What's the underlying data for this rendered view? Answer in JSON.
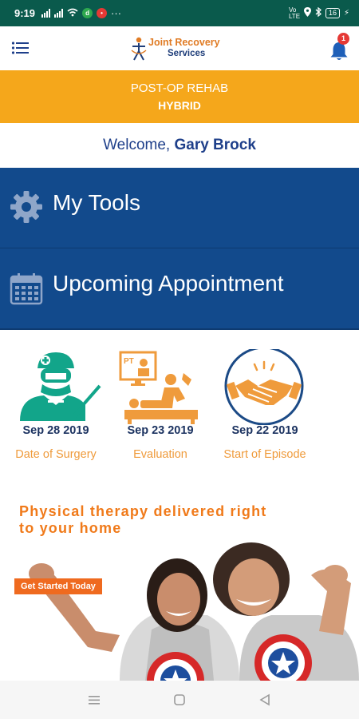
{
  "status_bar": {
    "time": "9:19",
    "battery": "16",
    "network_label": "Vo LTE"
  },
  "header": {
    "logo_line1": "Joint Recovery",
    "logo_line2": "Services",
    "notification_count": "1"
  },
  "program": {
    "line1": "POST-OP REHAB",
    "line2": "HYBRID"
  },
  "welcome": {
    "prefix": "Welcome,",
    "name": "Gary Brock"
  },
  "menu": {
    "tools_label": "My Tools",
    "appointment_label": "Upcoming Appointment"
  },
  "timeline": [
    {
      "date": "Sep 28 2019",
      "caption": "Date of Surgery",
      "icon": "surgeon-icon"
    },
    {
      "date": "Sep 23 2019",
      "caption": "Evaluation",
      "icon": "physical-therapy-icon",
      "badge": "PT"
    },
    {
      "date": "Sep 22 2019",
      "caption": "Start of Episode",
      "icon": "handshake-icon"
    }
  ],
  "promo": {
    "headline": "Physical therapy delivered right to your home",
    "cta_label": "Get Started Today"
  },
  "colors": {
    "status_bar": "#0a5a4c",
    "banner": "#f5a71b",
    "primary_blue": "#124a8c",
    "accent_orange": "#ef9b3c",
    "teal": "#12a58a"
  }
}
